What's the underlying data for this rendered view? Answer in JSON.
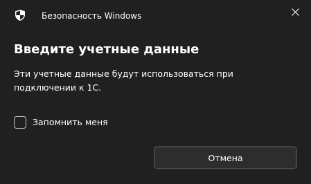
{
  "window": {
    "app_title": "Безопасность Windows",
    "app_icon": "shield-icon",
    "close_icon": "close-icon"
  },
  "dialog": {
    "heading": "Введите учетные данные",
    "message": "Эти учетные данные будут использоваться при подключении к 1C.",
    "remember_label": "Запомнить меня",
    "remember_checked": false,
    "cancel_label": "Отмена"
  },
  "colors": {
    "background": "#202020",
    "text": "#ffffff",
    "button_bg": "#2d2d2d"
  }
}
